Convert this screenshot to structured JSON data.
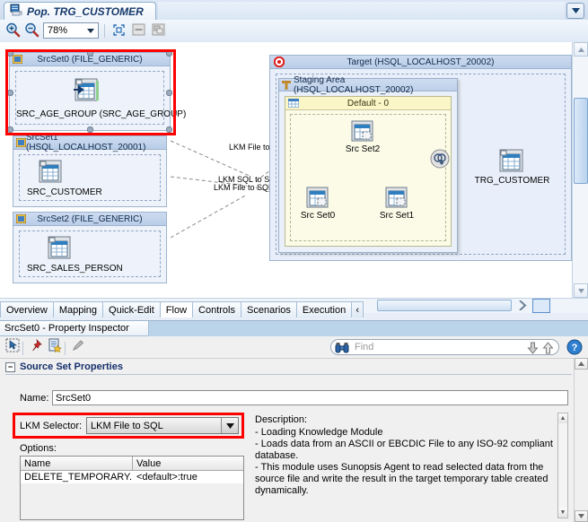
{
  "editor_tab": {
    "title": "Pop. TRG_CUSTOMER",
    "icon": "diagram-icon"
  },
  "toolbar": {
    "zoom_in": "zoom-in-icon",
    "zoom_out": "zoom-out-icon",
    "zoom_value": "78%",
    "fit_icon": "fit-to-window-icon",
    "collapse_icon": "collapse-all-icon",
    "expand_icon": "expand-all-icon"
  },
  "diagram": {
    "source_sets": [
      {
        "title": "SrcSet0 (FILE_GENERIC)",
        "node": "SRC_AGE_GROUP (SRC_AGE_GROUP)",
        "selected": true
      },
      {
        "title": "SrcSet1 (HSQL_LOCALHOST_20001)",
        "node": "SRC_CUSTOMER",
        "selected": false
      },
      {
        "title": "SrcSet2 (FILE_GENERIC)",
        "node": "SRC_SALES_PERSON",
        "selected": false
      }
    ],
    "target": {
      "title": "Target (HSQL_LOCALHOST_20002)",
      "staging": {
        "title": "Staging Area (HSQL_LOCALHOST_20002)",
        "default_set": "Default - 0",
        "nodes": [
          "Src Set2",
          "Src Set0",
          "Src Set1"
        ]
      },
      "target_node": "TRG_CUSTOMER"
    },
    "edge_labels": [
      "LKM File to  SQL",
      "LKM SQL to SQL",
      "LKM File to SQL"
    ]
  },
  "bottom_tabs": {
    "items": [
      "Overview",
      "Mapping",
      "Quick-Edit",
      "Flow",
      "Controls",
      "Scenarios",
      "Execution"
    ],
    "selected": "Flow",
    "more": "‹"
  },
  "property_inspector": {
    "tab_title": "SrcSet0 - Property Inspector",
    "toolbar_icons": [
      "select-icon",
      "pin-icon",
      "new-document-icon",
      "edit-pencil-icon"
    ],
    "find": {
      "icon": "binoculars-icon",
      "placeholder": "Find",
      "down": "find-down-icon",
      "up": "find-up-icon",
      "help": "help-icon"
    },
    "section_title": "Source Set Properties",
    "fields": {
      "name_label": "Name:",
      "name_value": "SrcSet0",
      "lkm_label": "LKM Selector:",
      "lkm_value": "LKM File to SQL",
      "options_label": "Options:"
    },
    "options_table": {
      "columns": [
        "Name",
        "Value"
      ],
      "rows": [
        [
          "DELETE_TEMPORARY...",
          "<default>:true"
        ]
      ]
    },
    "description": {
      "label": "Description:",
      "lines": [
        "- Loading Knowledge Module",
        "- Loads data from an ASCII or EBCDIC File to any ISO-92 compliant database.",
        "- This module uses Sunopsis Agent to read selected data from the source file and write the result in the target temporary table created dynamically."
      ]
    }
  },
  "colors": {
    "highlight": "#ff0000",
    "accent": "#16396b",
    "header": "#b9cde8"
  }
}
